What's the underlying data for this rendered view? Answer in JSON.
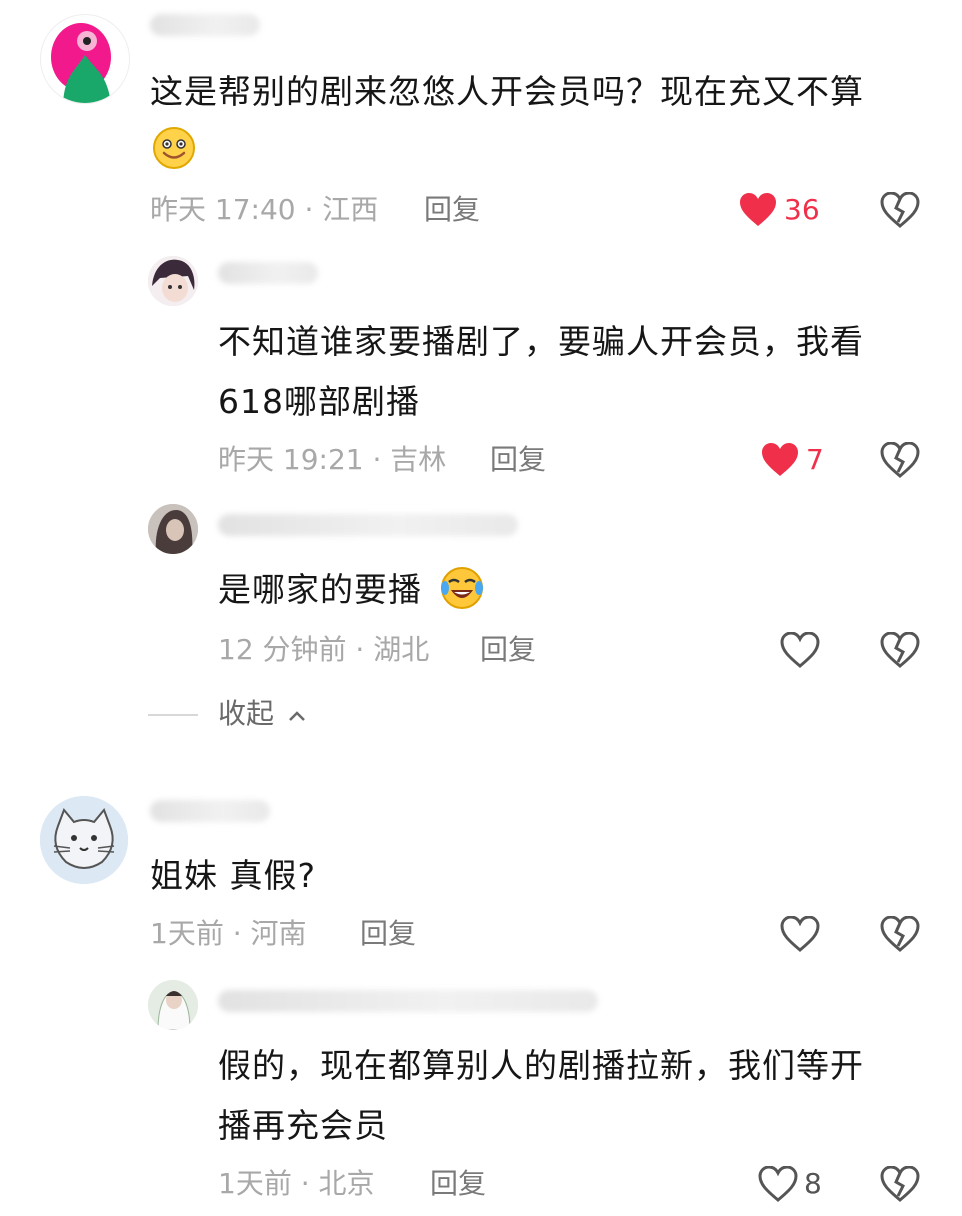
{
  "comments": [
    {
      "text_line1": "这是帮别的剧来忽悠人开会员吗？现在充又不算",
      "time_loc": "昨天 17:40 · 江西",
      "reply": "回复",
      "likes": "36",
      "liked": true
    },
    {
      "text_line1": "不知道谁家要播剧了，要骗人开会员，我看",
      "text_line2": "618哪部剧播",
      "time_loc": "昨天 19:21 · 吉林",
      "reply": "回复",
      "likes": "7",
      "liked": true
    },
    {
      "text_line1": "是哪家的要播",
      "time_loc": "12 分钟前 · 湖北",
      "reply": "回复"
    },
    {
      "text_line1": "姐妹 真假?",
      "time_loc": "1天前 · 河南",
      "reply": "回复"
    },
    {
      "text_line1": "假的，现在都算别人的剧播拉新，我们等开",
      "text_line2": "播再充会员",
      "time_loc": "1天前 · 北京",
      "reply": "回复",
      "likes": "8",
      "liked": false
    }
  ],
  "collapse_label": "收起",
  "colors": {
    "like_red": "#f0304a",
    "meta_gray": "#a8a8a8"
  }
}
